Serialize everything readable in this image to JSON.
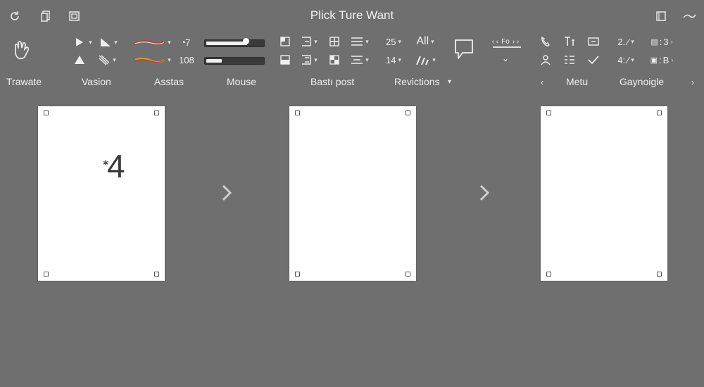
{
  "window": {
    "title": "Plick Ture Want"
  },
  "ribbon": {
    "row1": {
      "size_value": "25",
      "all_label": "All",
      "opacity_value": "7",
      "comment_label": "Fo",
      "list_value": "2.",
      "list_value2": "3"
    },
    "row2": {
      "size_value": "14",
      "number_value": "108",
      "list_value": "4:",
      "list_value2": "B"
    },
    "brush_slider_fraction": 0.8,
    "opacity_slider_fraction": 0.3
  },
  "groups": [
    "Trawate",
    "Vasion",
    "Asstas",
    "Mouse",
    "Bastı post",
    "Revictions",
    "Metu",
    "Gaynoigle"
  ],
  "pages": {
    "first_page_number": "4"
  },
  "icons": {
    "refresh": "refresh-icon",
    "copy": "copy-icon",
    "gallery": "gallery-icon",
    "window": "window-icon",
    "minimize": "minimize-icon"
  }
}
